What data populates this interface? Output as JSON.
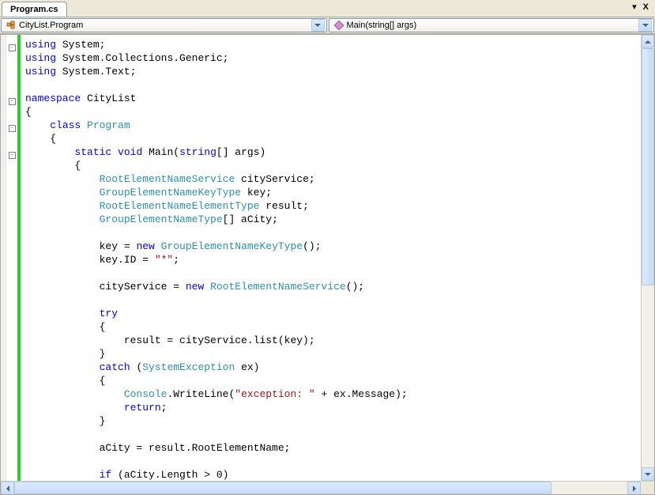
{
  "tab": {
    "label": "Program.cs"
  },
  "tab_controls": {
    "menu": "▾",
    "close": "X"
  },
  "dropdowns": {
    "class": {
      "text": "CityList.Program"
    },
    "method": {
      "text": "Main(string[] args)"
    }
  },
  "code": {
    "lines": [
      {
        "indent": 0,
        "fold": "-",
        "tokens": [
          [
            "kw",
            "using"
          ],
          [
            "",
            " System;"
          ]
        ]
      },
      {
        "indent": 0,
        "tokens": [
          [
            "kw",
            "using"
          ],
          [
            "",
            " System.Collections.Generic;"
          ]
        ]
      },
      {
        "indent": 0,
        "tokens": [
          [
            "kw",
            "using"
          ],
          [
            "",
            " System.Text;"
          ]
        ]
      },
      {
        "indent": 0,
        "tokens": [
          [
            "",
            ""
          ]
        ]
      },
      {
        "indent": 0,
        "fold": "-",
        "tokens": [
          [
            "kw",
            "namespace"
          ],
          [
            "",
            " CityList"
          ]
        ]
      },
      {
        "indent": 0,
        "tokens": [
          [
            "",
            "{"
          ]
        ]
      },
      {
        "indent": 1,
        "fold": "-",
        "tokens": [
          [
            "kw",
            "class"
          ],
          [
            "",
            " "
          ],
          [
            "typ",
            "Program"
          ]
        ]
      },
      {
        "indent": 1,
        "tokens": [
          [
            "",
            "{"
          ]
        ]
      },
      {
        "indent": 2,
        "fold": "-",
        "tokens": [
          [
            "kw",
            "static"
          ],
          [
            "",
            " "
          ],
          [
            "kw",
            "void"
          ],
          [
            "",
            " Main("
          ],
          [
            "kw",
            "string"
          ],
          [
            "",
            "[] args)"
          ]
        ]
      },
      {
        "indent": 2,
        "tokens": [
          [
            "",
            "{"
          ]
        ]
      },
      {
        "indent": 3,
        "tokens": [
          [
            "typ",
            "RootElementNameService"
          ],
          [
            "",
            " cityService;"
          ]
        ]
      },
      {
        "indent": 3,
        "tokens": [
          [
            "typ",
            "GroupElementNameKeyType"
          ],
          [
            "",
            " key;"
          ]
        ]
      },
      {
        "indent": 3,
        "tokens": [
          [
            "typ",
            "RootElementNameElementType"
          ],
          [
            "",
            " result;"
          ]
        ]
      },
      {
        "indent": 3,
        "tokens": [
          [
            "typ",
            "GroupElementNameType"
          ],
          [
            "",
            "[] aCity;"
          ]
        ]
      },
      {
        "indent": 3,
        "tokens": [
          [
            "",
            ""
          ]
        ]
      },
      {
        "indent": 3,
        "tokens": [
          [
            "",
            "key = "
          ],
          [
            "kw",
            "new"
          ],
          [
            "",
            " "
          ],
          [
            "typ",
            "GroupElementNameKeyType"
          ],
          [
            "",
            "();"
          ]
        ]
      },
      {
        "indent": 3,
        "tokens": [
          [
            "",
            "key.ID = "
          ],
          [
            "str",
            "\"*\""
          ],
          [
            "",
            ";"
          ]
        ]
      },
      {
        "indent": 3,
        "tokens": [
          [
            "",
            ""
          ]
        ]
      },
      {
        "indent": 3,
        "tokens": [
          [
            "",
            "cityService = "
          ],
          [
            "kw",
            "new"
          ],
          [
            "",
            " "
          ],
          [
            "typ",
            "RootElementNameService"
          ],
          [
            "",
            "();"
          ]
        ]
      },
      {
        "indent": 3,
        "tokens": [
          [
            "",
            ""
          ]
        ]
      },
      {
        "indent": 3,
        "tokens": [
          [
            "kw",
            "try"
          ]
        ]
      },
      {
        "indent": 3,
        "tokens": [
          [
            "",
            "{"
          ]
        ]
      },
      {
        "indent": 4,
        "tokens": [
          [
            "",
            "result = cityService.list(key);"
          ]
        ]
      },
      {
        "indent": 3,
        "tokens": [
          [
            "",
            "}"
          ]
        ]
      },
      {
        "indent": 3,
        "tokens": [
          [
            "kw",
            "catch"
          ],
          [
            "",
            " ("
          ],
          [
            "typ",
            "SystemException"
          ],
          [
            "",
            " ex)"
          ]
        ]
      },
      {
        "indent": 3,
        "tokens": [
          [
            "",
            "{"
          ]
        ]
      },
      {
        "indent": 4,
        "tokens": [
          [
            "typ",
            "Console"
          ],
          [
            "",
            ".WriteLine("
          ],
          [
            "str",
            "\"exception: \""
          ],
          [
            "",
            " + ex.Message);"
          ]
        ]
      },
      {
        "indent": 4,
        "tokens": [
          [
            "kw",
            "return"
          ],
          [
            "",
            ";"
          ]
        ]
      },
      {
        "indent": 3,
        "tokens": [
          [
            "",
            "}"
          ]
        ]
      },
      {
        "indent": 3,
        "tokens": [
          [
            "",
            ""
          ]
        ]
      },
      {
        "indent": 3,
        "tokens": [
          [
            "",
            "aCity = result.RootElementName;"
          ]
        ]
      },
      {
        "indent": 3,
        "tokens": [
          [
            "",
            ""
          ]
        ]
      },
      {
        "indent": 3,
        "tokens": [
          [
            "kw",
            "if"
          ],
          [
            "",
            " (aCity.Length > 0)"
          ]
        ]
      }
    ]
  }
}
